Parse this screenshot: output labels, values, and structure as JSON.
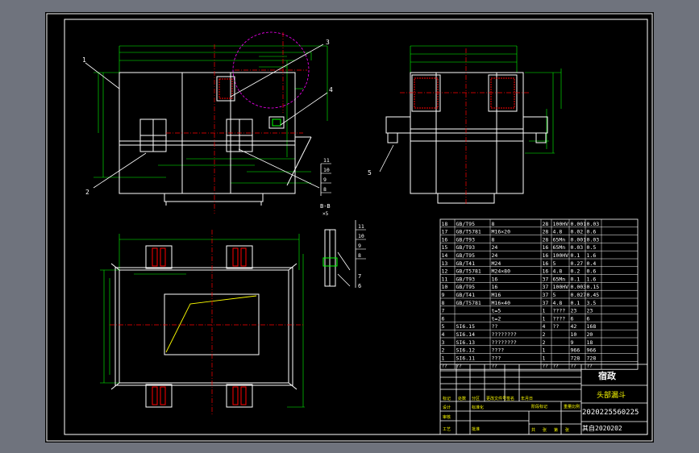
{
  "callouts": [
    "1",
    "2",
    "3",
    "4",
    "5",
    "7",
    "6"
  ],
  "section_label": "B-B",
  "section_scale": "×5",
  "stack_labels": [
    "11",
    "10",
    "9",
    "8"
  ],
  "stack_labels_b": [
    "11",
    "10",
    "9",
    "8"
  ],
  "bom_rows": [
    {
      "no": "18",
      "std": "GB/T95",
      "spec": "8",
      "qty": "28",
      "mat": "100HV",
      "w1": "0.001",
      "w2": "0.03"
    },
    {
      "no": "17",
      "std": "GB/T5781",
      "spec": "M16×20",
      "qty": "28",
      "mat": "4.8",
      "w1": "0.02",
      "w2": "0.6"
    },
    {
      "no": "16",
      "std": "GB/T93",
      "spec": "8",
      "qty": "28",
      "mat": "65Mn",
      "w1": "0.001",
      "w2": "0.03"
    },
    {
      "no": "15",
      "std": "GB/T93",
      "spec": "24",
      "qty": "16",
      "mat": "65Mn",
      "w1": "0.03",
      "w2": "0.5"
    },
    {
      "no": "14",
      "std": "GB/T95",
      "spec": "24",
      "qty": "16",
      "mat": "100HV",
      "w1": "0.1",
      "w2": "1.6"
    },
    {
      "no": "13",
      "std": "GB/T41",
      "spec": "M24",
      "qty": "16",
      "mat": "5",
      "w1": "0.27",
      "w2": "0.4"
    },
    {
      "no": "12",
      "std": "GB/T5781",
      "spec": "M24×80",
      "qty": "16",
      "mat": "4.8",
      "w1": "0.2",
      "w2": "0.6"
    },
    {
      "no": "11",
      "std": "GB/T93",
      "spec": "16",
      "qty": "37",
      "mat": "65Mn",
      "w1": "0.1",
      "w2": "1.6"
    },
    {
      "no": "10",
      "std": "GB/T95",
      "spec": "16",
      "qty": "37",
      "mat": "100HV",
      "w1": "0.003",
      "w2": "0.15"
    },
    {
      "no": "9",
      "std": "GB/T41",
      "spec": "M16",
      "qty": "37",
      "mat": "5",
      "w1": "0.027",
      "w2": "0.45"
    },
    {
      "no": "8",
      "std": "GB/T5781",
      "spec": "M16×40",
      "qty": "37",
      "mat": "4.8",
      "w1": "0.1",
      "w2": "3.5"
    },
    {
      "no": "7",
      "std": "",
      "spec": "t=5",
      "qty": "1",
      "mat": "????",
      "w1": "23",
      "w2": "23"
    },
    {
      "no": "6",
      "std": "",
      "spec": "t=2",
      "qty": "1",
      "mat": "????",
      "w1": "6",
      "w2": "6"
    },
    {
      "no": "5",
      "std": "SI6.15",
      "spec": "??",
      "qty": "4",
      "mat": "??",
      "w1": "42",
      "w2": "168"
    },
    {
      "no": "4",
      "std": "SI6.14",
      "spec": "????????",
      "qty": "2",
      "mat": "",
      "w1": "10",
      "w2": "20"
    },
    {
      "no": "3",
      "std": "SI6.13",
      "spec": "????????",
      "qty": "2",
      "mat": "",
      "w1": "9",
      "w2": "18"
    },
    {
      "no": "2",
      "std": "SI6.12",
      "spec": "????",
      "qty": "1",
      "mat": "",
      "w1": "966",
      "w2": "966"
    },
    {
      "no": "1",
      "std": "SI6.11",
      "spec": "???",
      "qty": "1",
      "mat": "",
      "w1": "728",
      "w2": "728"
    }
  ],
  "bom_header": [
    "??",
    "??",
    "??",
    "??",
    "??",
    "??",
    "??"
  ],
  "title_block": {
    "company": "宿政",
    "drawing_name": "头部漏斗",
    "drawing_no": "2020225560225",
    "drawing_no_sub": "其自2020202",
    "labels_row1": [
      "标记",
      "处数",
      "分区",
      "更改文件号",
      "签名",
      "年月日"
    ],
    "labels_row2": [
      "设计",
      "标准化"
    ],
    "labels_row3": [
      "审核"
    ],
    "labels_row4": [
      "工艺",
      "批准"
    ],
    "stage_labels": [
      "阶段标记",
      "重量",
      "比例"
    ],
    "sheet_labels": [
      "共",
      "张",
      "第",
      "张"
    ]
  },
  "colors": {
    "sheet": "#000000",
    "frame": "#ffffff",
    "outline": "#ffffff",
    "dimension": "#00ff00",
    "centerline": "#ff0000",
    "hidden": "#ff00ff",
    "leader": "#ffffff",
    "text_table": "#ffffff"
  }
}
